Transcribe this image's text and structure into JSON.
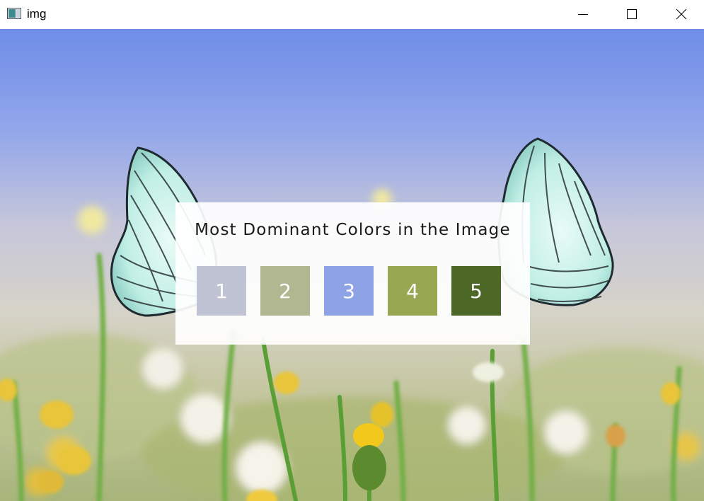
{
  "window": {
    "title": "img",
    "controls": {
      "minimize_icon": "minimize-icon",
      "maximize_icon": "maximize-icon",
      "close_icon": "close-icon"
    }
  },
  "panel": {
    "title": "Most Dominant Colors in the Image",
    "swatches": [
      {
        "label": "1",
        "color": "#bfc3d3"
      },
      {
        "label": "2",
        "color": "#b0b791"
      },
      {
        "label": "3",
        "color": "#8ea3e6"
      },
      {
        "label": "4",
        "color": "#98a752"
      },
      {
        "label": "5",
        "color": "#4c6726"
      }
    ]
  }
}
